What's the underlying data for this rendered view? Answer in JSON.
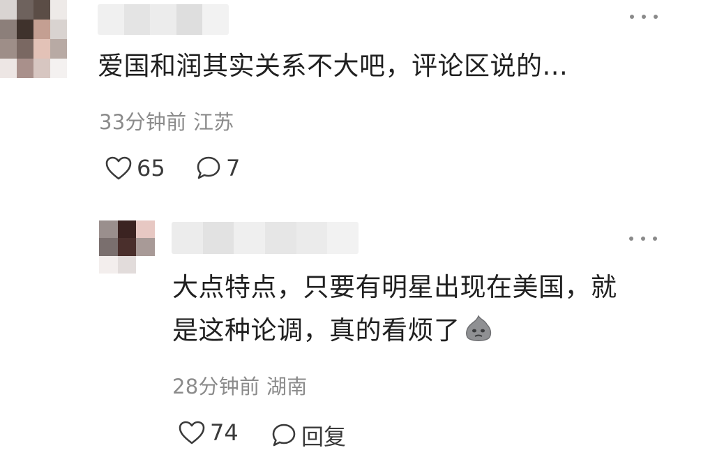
{
  "comments": [
    {
      "text": "爱国和润其实关系不大吧，评论区说的...",
      "time": "33分钟前",
      "location": "江苏",
      "likes": "65",
      "comments_count": "7"
    }
  ],
  "replies": [
    {
      "text_line1": "大点特点，只要有明星出现在美国，就",
      "text_line2": "是这种论调，真的看烦了",
      "emoji": "blob-emoji",
      "time": "28分钟前",
      "location": "湖南",
      "likes": "74",
      "reply_label": "回复"
    }
  ],
  "icons": {
    "like": "heart-outline-icon",
    "comment": "speech-bubble-icon",
    "more": "ellipsis-icon"
  },
  "colors": {
    "text": "#202020",
    "meta": "#8b8b8b",
    "icon": "#3a3a3a"
  }
}
